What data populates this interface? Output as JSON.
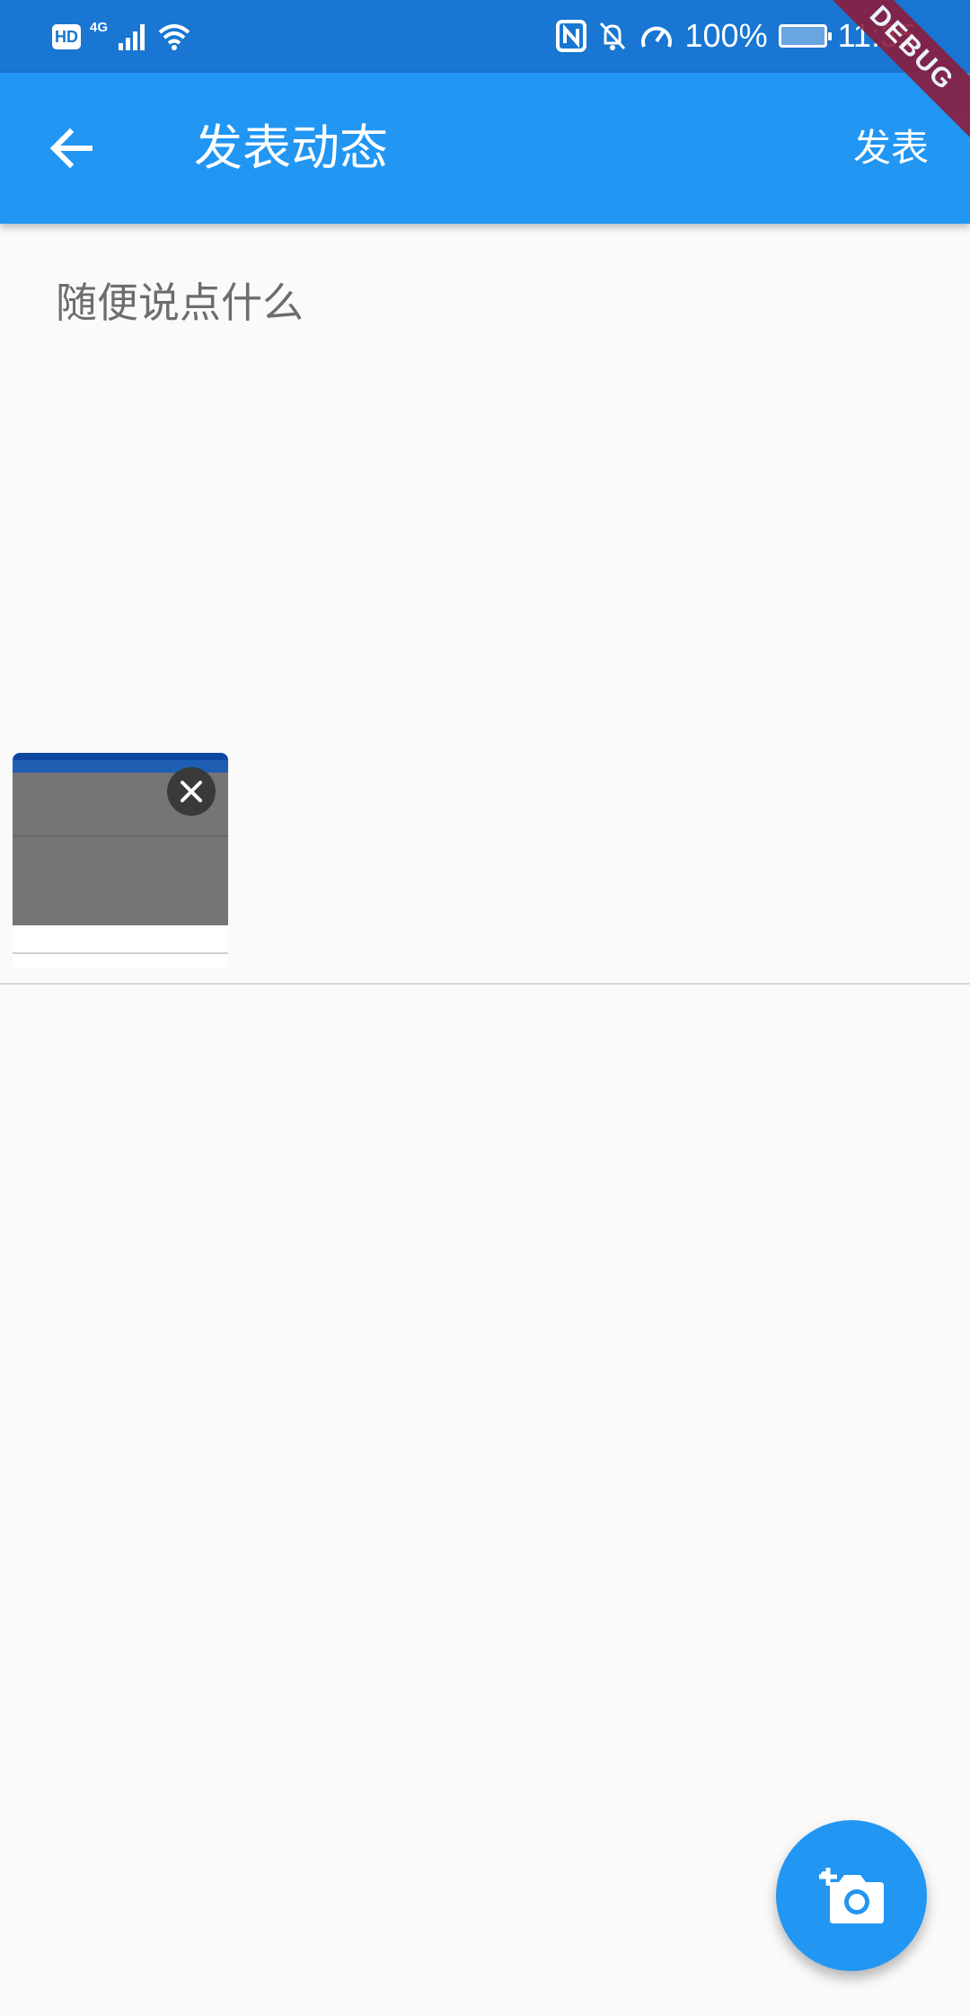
{
  "status_bar": {
    "hd": "HD",
    "network": "4G",
    "battery_percent": "100%",
    "time": "11:35"
  },
  "debug_banner": "DEBUG",
  "app_bar": {
    "title": "发表动态",
    "publish_label": "发表",
    "back_icon": "arrow-left-icon"
  },
  "composer": {
    "placeholder": "随便说点什么",
    "value": ""
  },
  "attachments": [
    {
      "kind": "screenshot-thumbnail",
      "remove_icon": "close-icon"
    }
  ],
  "fab": {
    "icon": "add-a-photo-icon"
  },
  "colors": {
    "status_bar": "#1976d2",
    "app_bar": "#2196f3",
    "accent": "#2196f3",
    "background": "#fafafa",
    "debug_ribbon": "#8b1c3c"
  }
}
